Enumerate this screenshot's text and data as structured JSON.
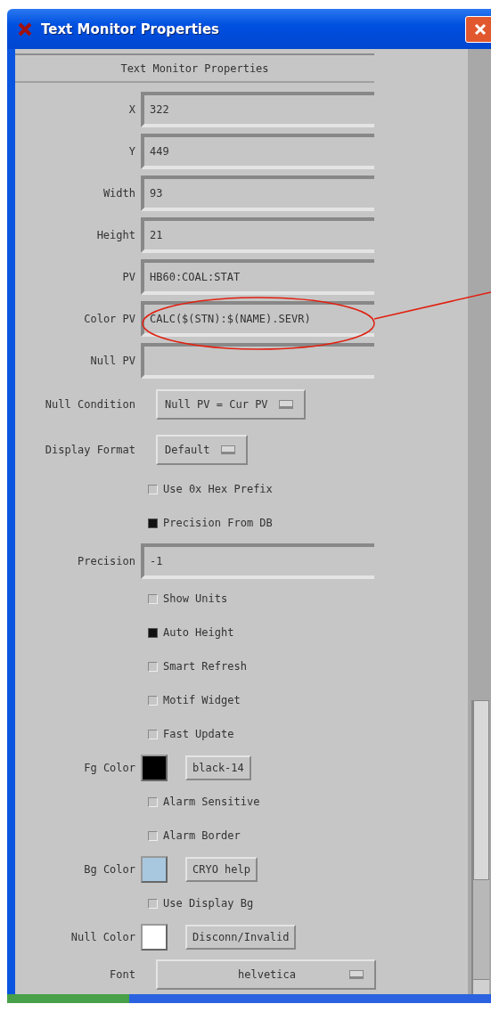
{
  "window": {
    "title": "Text Monitor Properties"
  },
  "panel": {
    "heading": "Text Monitor Properties",
    "rows": [
      {
        "kind": "field",
        "label": "X",
        "value": "322"
      },
      {
        "kind": "field",
        "label": "Y",
        "value": "449"
      },
      {
        "kind": "field",
        "label": "Width",
        "value": "93"
      },
      {
        "kind": "field",
        "label": "Height",
        "value": "21"
      },
      {
        "kind": "field",
        "label": "PV",
        "value": "HB60:COAL:STAT"
      },
      {
        "kind": "field",
        "label": "Color PV",
        "value": "CALC($(STN):$(NAME).SEVR)"
      },
      {
        "kind": "field",
        "label": "Null PV"
      },
      {
        "kind": "menu",
        "label": "Null Condition",
        "value": "Null PV = Cur PV"
      },
      {
        "kind": "menu",
        "label": "Display Format",
        "value": "Default"
      },
      {
        "kind": "check",
        "label": "Use 0x Hex Prefix",
        "checked": false
      },
      {
        "kind": "check",
        "label": "Precision From DB",
        "checked": true
      },
      {
        "kind": "field",
        "label": "Precision",
        "value": "-1"
      },
      {
        "kind": "check",
        "label": "Show Units",
        "checked": false
      },
      {
        "kind": "check",
        "label": "Auto Height",
        "checked": true
      },
      {
        "kind": "check",
        "label": "Smart Refresh",
        "checked": false
      },
      {
        "kind": "check",
        "label": "Motif Widget",
        "checked": false
      },
      {
        "kind": "check",
        "label": "Fast Update",
        "checked": false
      },
      {
        "kind": "color",
        "label": "Fg Color",
        "color": "#000000",
        "button": "black-14"
      },
      {
        "kind": "check",
        "label": "Alarm Sensitive",
        "checked": false
      },
      {
        "kind": "check",
        "label": "Alarm Border",
        "checked": false
      },
      {
        "kind": "color",
        "label": "Bg Color",
        "color": "#a8c8e0",
        "button": "CRYO help"
      },
      {
        "kind": "check",
        "label": "Use Display Bg",
        "checked": false
      },
      {
        "kind": "color",
        "label": "Null Color",
        "color": "#ffffff",
        "button": "Disconn/Invalid"
      },
      {
        "kind": "menu",
        "label": "Font",
        "value": "helvetica"
      }
    ]
  }
}
